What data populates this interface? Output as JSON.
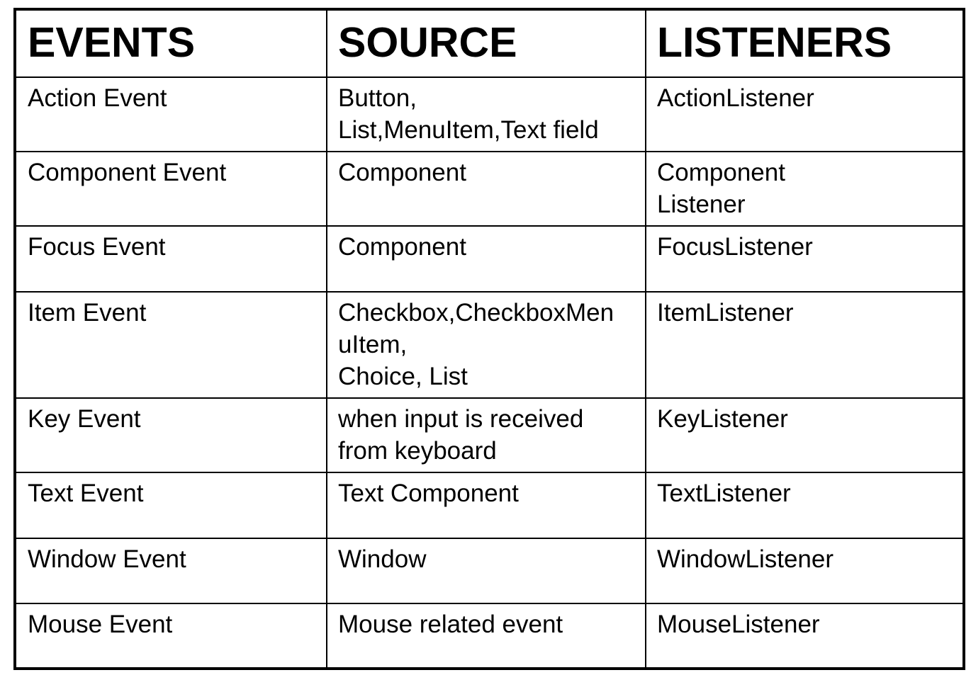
{
  "headers": [
    "EVENTS",
    "SOURCE",
    "LISTENERS"
  ],
  "rows": [
    {
      "event": "Action Event",
      "source": "Button,\nList,MenuItem,Text field",
      "listener": "ActionListener"
    },
    {
      "event": "Component Event",
      "source": "Component",
      "listener": "Component\nListener"
    },
    {
      "event": "Focus Event",
      "source": "Component",
      "listener": "FocusListener"
    },
    {
      "event": "Item Event",
      "source": "Checkbox,CheckboxMen\nuItem,\nChoice, List",
      "listener": "ItemListener"
    },
    {
      "event": "Key Event",
      "source": "when input is received\nfrom keyboard",
      "listener": "KeyListener"
    },
    {
      "event": "Text Event",
      "source": "Text Component",
      "listener": "TextListener"
    },
    {
      "event": "Window Event",
      "source": "Window",
      "listener": "WindowListener"
    },
    {
      "event": "Mouse Event",
      "source": "Mouse related event",
      "listener": "MouseListener"
    }
  ]
}
